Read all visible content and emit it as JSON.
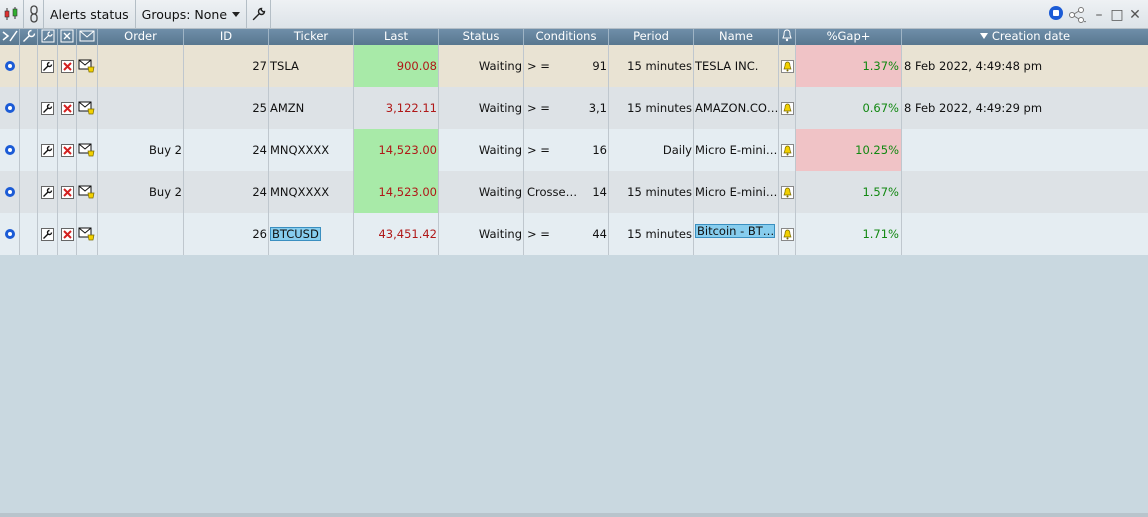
{
  "toolbar": {
    "title": "Alerts status",
    "groups_label": "Groups: None",
    "icons": [
      "chart-candles-icon",
      "link-chain-icon",
      "wrench-icon",
      "record-icon",
      "share-icon",
      "minimize-icon",
      "maximize-icon",
      "close-icon"
    ],
    "window_min": "–",
    "window_max": "□",
    "window_close": "✕"
  },
  "header": {
    "order": "Order",
    "id": "ID",
    "ticker": "Ticker",
    "last": "Last",
    "status": "Status",
    "conditions": "Conditions",
    "period": "Period",
    "name": "Name",
    "gap": "%Gap+",
    "created": "Creation date"
  },
  "colors": {
    "row_tan": "#e9e3d3",
    "row_gray": "#dde2e6",
    "row_light": "#e5edf2",
    "green_cell": "#a8eaa8",
    "pink_cell": "#f0c3c6",
    "red_text": "#b01818",
    "green_text": "#118811",
    "header_bg": "#63829c",
    "body_bg": "#c9d8e0"
  },
  "rows": [
    {
      "order": "",
      "id": "27",
      "ticker": "TSLA",
      "last": "900.08",
      "status": "Waiting",
      "cond_op": "> =",
      "cond_val": "91",
      "period": "15 minutes",
      "name": "TESLA INC.",
      "gap": "1.37%",
      "created": "8 Feb 2022, 4:49:48 pm"
    },
    {
      "order": "",
      "id": "25",
      "ticker": "AMZN",
      "last": "3,122.11",
      "status": "Waiting",
      "cond_op": "> =",
      "cond_val": "3,1",
      "period": "15 minutes",
      "name": "AMAZON.CO…",
      "gap": "0.67%",
      "created": "8 Feb 2022, 4:49:29 pm"
    },
    {
      "order": "Buy 2",
      "id": "24",
      "ticker": "MNQXXXX",
      "last": "14,523.00",
      "status": "Waiting",
      "cond_op": "> =",
      "cond_val": "16",
      "period": "Daily",
      "name": "Micro E-mini…",
      "gap": "10.25%",
      "created": ""
    },
    {
      "order": "Buy 2",
      "id": "24",
      "ticker": "MNQXXXX",
      "last": "14,523.00",
      "status": "Waiting",
      "cond_op": "Crosse…",
      "cond_val": "14",
      "period": "15 minutes",
      "name": "Micro E-mini…",
      "gap": "1.57%",
      "created": ""
    },
    {
      "order": "",
      "id": "26",
      "ticker": "BTCUSD",
      "last": "43,451.42",
      "status": "Waiting",
      "cond_op": "> =",
      "cond_val": "44",
      "period": "15 minutes",
      "name": "Bitcoin - BT…",
      "gap": "1.71%",
      "created": ""
    }
  ]
}
